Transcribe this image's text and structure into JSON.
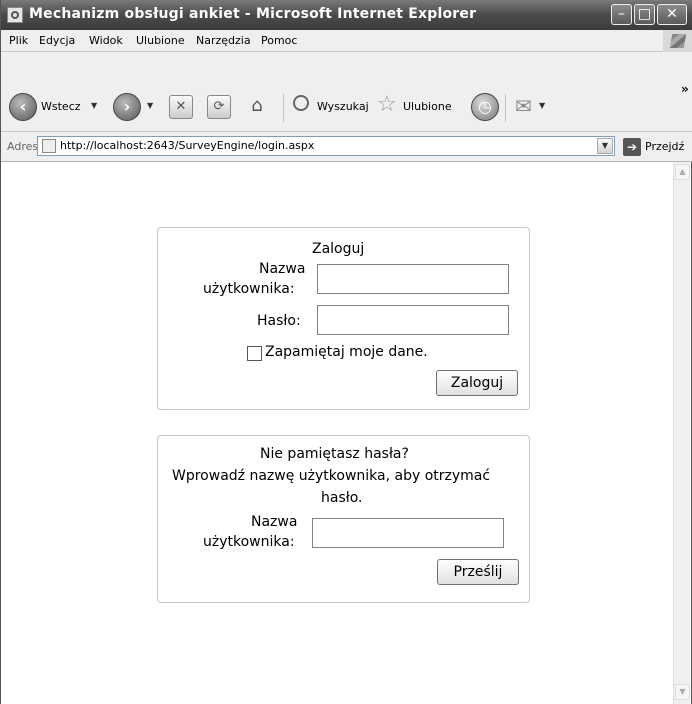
{
  "window": {
    "title": "Mechanizm obsługi ankiet - Microsoft Internet Explorer",
    "buttons": {
      "minimize": "–",
      "maximize": "□",
      "close": "✕"
    }
  },
  "menu": {
    "items": [
      "Plik",
      "Edycja",
      "Widok",
      "Ulubione",
      "Narzędzia",
      "Pomoc"
    ]
  },
  "toolbar": {
    "back_label": "Wstecz",
    "search_label": "Wyszukaj",
    "favorites_label": "Ulubione",
    "more": "»"
  },
  "address": {
    "label": "Adres",
    "url": "http://localhost:2643/SurveyEngine/login.aspx",
    "go_label": "Przejdź"
  },
  "login": {
    "title": "Zaloguj",
    "username_label_line1": "Nazwa",
    "username_label_line2": "użytkownika:",
    "username_value": "",
    "password_label": "Hasło:",
    "password_value": "",
    "remember_label": "Zapamiętaj moje dane.",
    "remember_checked": false,
    "submit_label": "Zaloguj"
  },
  "recovery": {
    "title": "Nie pamiętasz hasła?",
    "instruction_line1": "Wprowadź nazwę użytkownika, aby otrzymać",
    "instruction_line2": "hasło.",
    "username_label_line1": "Nazwa",
    "username_label_line2": "użytkownika:",
    "username_value": "",
    "submit_label": "Prześlij"
  }
}
